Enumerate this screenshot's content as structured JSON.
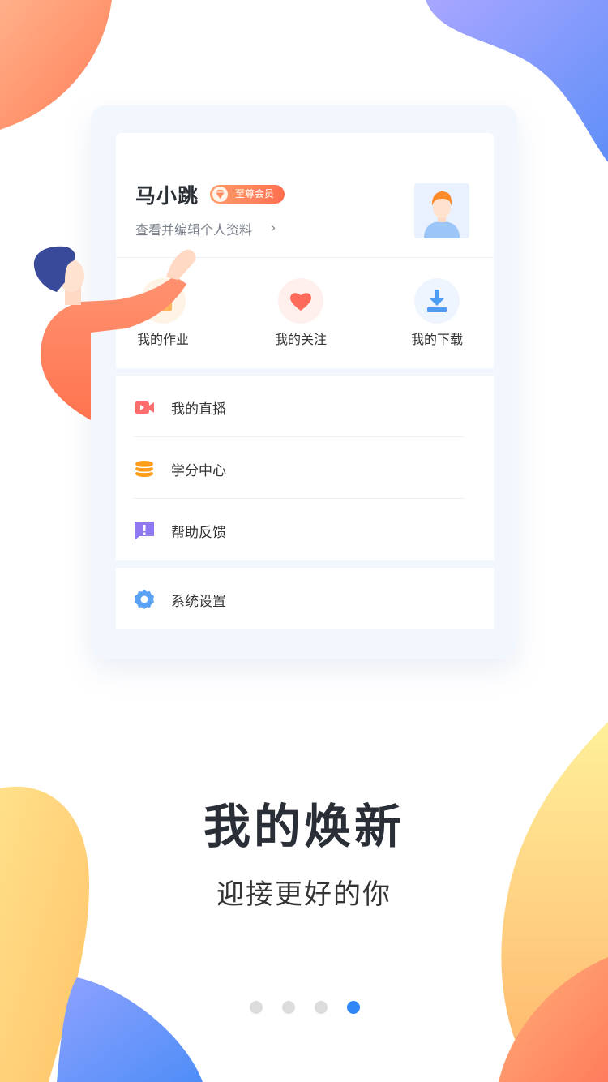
{
  "profile": {
    "name": "马小跳",
    "badge": "至尊会员",
    "edit_link": "查看并编辑个人资料",
    "chevron": "›"
  },
  "quick_actions": [
    {
      "label": "我的作业",
      "icon": "homework-icon",
      "color": "#ffb35c"
    },
    {
      "label": "我的关注",
      "icon": "heart-icon",
      "color": "#ff6b5b"
    },
    {
      "label": "我的下载",
      "icon": "download-icon",
      "color": "#4f9cf5"
    }
  ],
  "menu": [
    {
      "label": "我的直播",
      "icon": "video-icon",
      "color": "#ff6e6e"
    },
    {
      "label": "学分中心",
      "icon": "coins-icon",
      "color": "#ff9d1b"
    },
    {
      "label": "帮助反馈",
      "icon": "feedback-icon",
      "color": "#8f78f0"
    }
  ],
  "settings": {
    "label": "系统设置",
    "icon": "gear-icon",
    "color": "#5aa2f5"
  },
  "headline": "我的焕新",
  "tagline": "迎接更好的你",
  "pager": {
    "total": 4,
    "current": 4,
    "active_color": "#2f86f6"
  }
}
